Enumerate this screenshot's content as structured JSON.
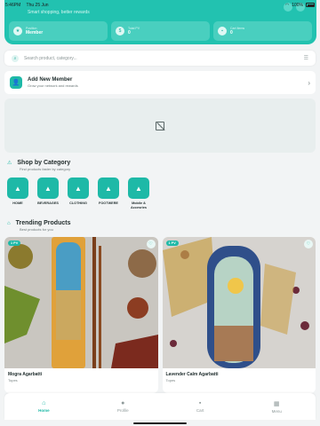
{
  "status_bar": {
    "time": "5:46PM",
    "date": "Thu 25 Jun",
    "battery": "100%"
  },
  "hero": {
    "subtitle": "Smart shopping, better rewards",
    "stats": [
      {
        "label": "Position",
        "value": "Member",
        "icon": "badge-icon"
      },
      {
        "label": "Total PV",
        "value": "0",
        "icon": "dollar-icon"
      },
      {
        "label": "Cart Items",
        "value": "0",
        "icon": "cart-icon"
      }
    ]
  },
  "search": {
    "placeholder": "Search product, category..."
  },
  "member_card": {
    "title": "Add New Member",
    "subtitle": "Grow your network and rewards"
  },
  "categories_section": {
    "title": "Shop by Category",
    "subtitle": "Find products faster by category",
    "items": [
      {
        "label": "HOME"
      },
      {
        "label": "BEVERAGES"
      },
      {
        "label": "CLOTHING"
      },
      {
        "label": "FOOTWERE"
      },
      {
        "label": "Mobile & Accesries"
      }
    ]
  },
  "trending_section": {
    "title": "Trending Products",
    "subtitle": "Best products for you",
    "products": [
      {
        "name": "Mogra Agarbatti",
        "type": "Topes",
        "badge": "1 PV"
      },
      {
        "name": "Lavender Calm Agarbatti",
        "type": "Topes",
        "badge": "1 PV"
      }
    ]
  },
  "nav": {
    "items": [
      {
        "label": "Home",
        "active": true
      },
      {
        "label": "Profile",
        "active": false
      },
      {
        "label": "Cart",
        "active": false
      },
      {
        "label": "Menu",
        "active": false
      }
    ]
  },
  "colors": {
    "accent": "#1eb9a7",
    "hero": "#22c2b0"
  }
}
